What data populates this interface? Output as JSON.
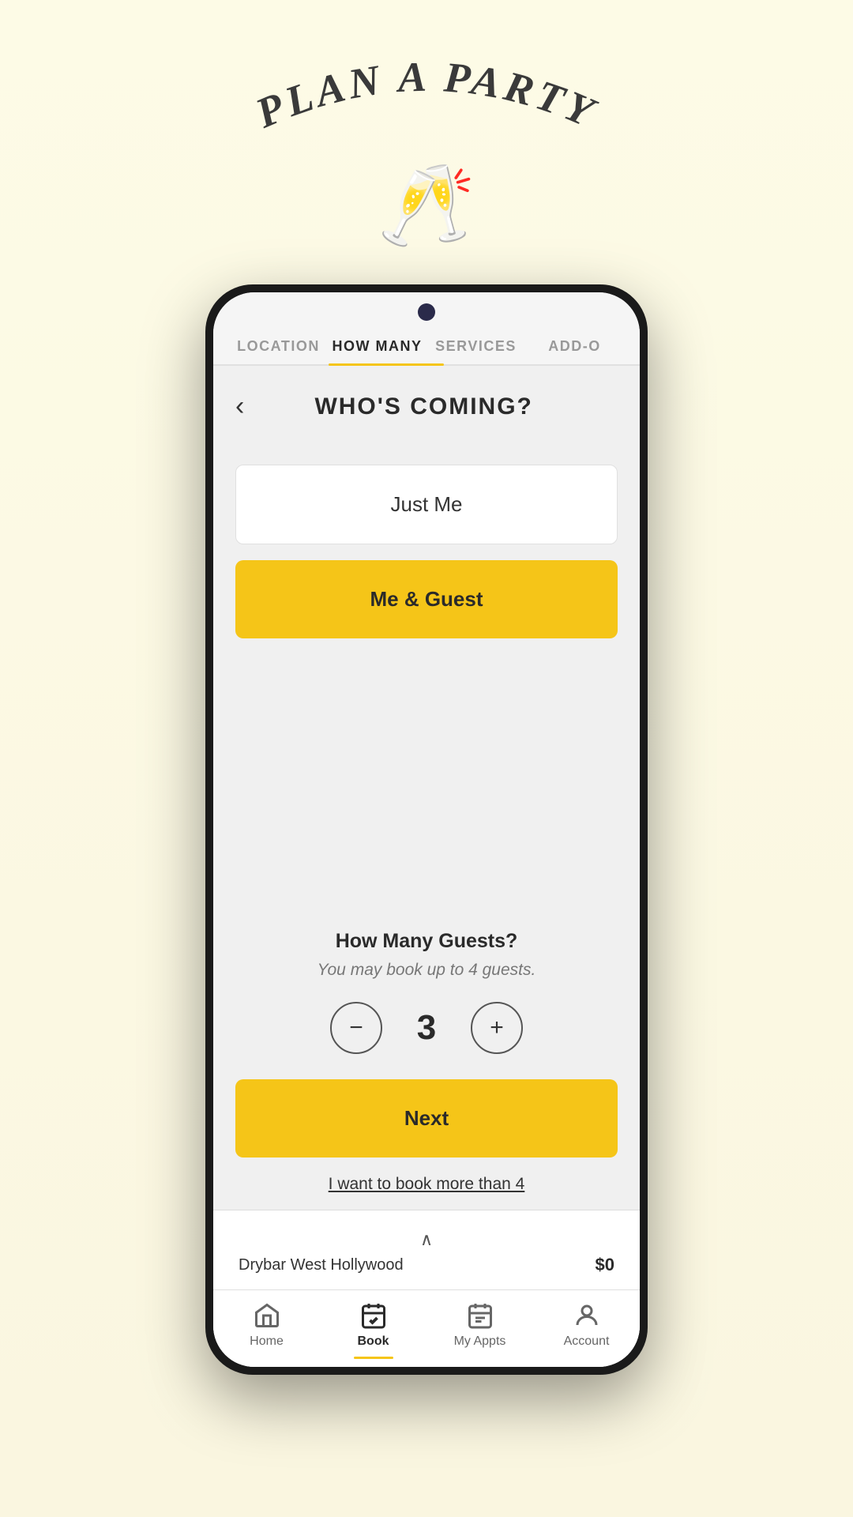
{
  "app": {
    "heading": "PLAN A PARTY"
  },
  "tabs": [
    {
      "id": "location",
      "label": "LOCATION",
      "active": false
    },
    {
      "id": "how-many",
      "label": "HOW MANY",
      "active": true
    },
    {
      "id": "services",
      "label": "SERVICES",
      "active": false
    },
    {
      "id": "add-ons",
      "label": "ADD-O",
      "active": false
    }
  ],
  "page": {
    "title": "WHO'S COMING?",
    "back_label": "<"
  },
  "options": [
    {
      "id": "just-me",
      "label": "Just Me",
      "selected": false
    },
    {
      "id": "me-guest",
      "label": "Me & Guest",
      "selected": true
    }
  ],
  "guests": {
    "label": "How Many Guests?",
    "sublabel": "You may book up to 4 guests.",
    "count": "3",
    "decrement_label": "−",
    "increment_label": "+"
  },
  "next_button": {
    "label": "Next"
  },
  "book_more": {
    "label": "I want to book more than 4"
  },
  "summary": {
    "chevron": "∧",
    "location": "Drybar West Hollywood",
    "price": "$0"
  },
  "bottom_nav": [
    {
      "id": "home",
      "label": "Home",
      "active": false,
      "icon": "home"
    },
    {
      "id": "book",
      "label": "Book",
      "active": true,
      "icon": "book"
    },
    {
      "id": "my-appts",
      "label": "My Appts",
      "active": false,
      "icon": "calendar"
    },
    {
      "id": "account",
      "label": "Account",
      "active": false,
      "icon": "person"
    }
  ]
}
